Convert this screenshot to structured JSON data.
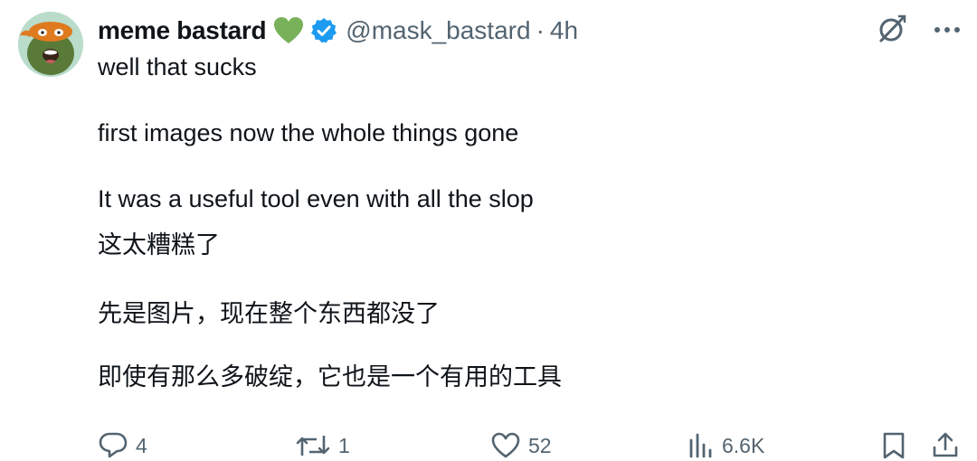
{
  "post": {
    "author": {
      "display_name": "meme bastard",
      "handle": "@mask_bastard",
      "heart_emoji_icon": "green-heart-icon",
      "verified_icon": "verified-badge-icon",
      "avatar_icon": "turtle-mask-avatar"
    },
    "separator": "·",
    "time": "4h",
    "lines": [
      "well that sucks",
      "first images now the whole things gone",
      "It was a useful tool even with all the slop",
      "这太糟糕了",
      "先是图片，现在整个东西都没了",
      "即使有那么多破绽，它也是一个有用的工具"
    ],
    "top_icons": [
      "grok-icon",
      "more-icon"
    ],
    "actions": {
      "replies": "4",
      "reposts": "1",
      "likes": "52",
      "views": "6.6K"
    }
  },
  "colors": {
    "text_primary": "#0f1419",
    "text_secondary": "#536471",
    "verified_blue": "#1d9bf0",
    "heart_green": "#78b159"
  }
}
